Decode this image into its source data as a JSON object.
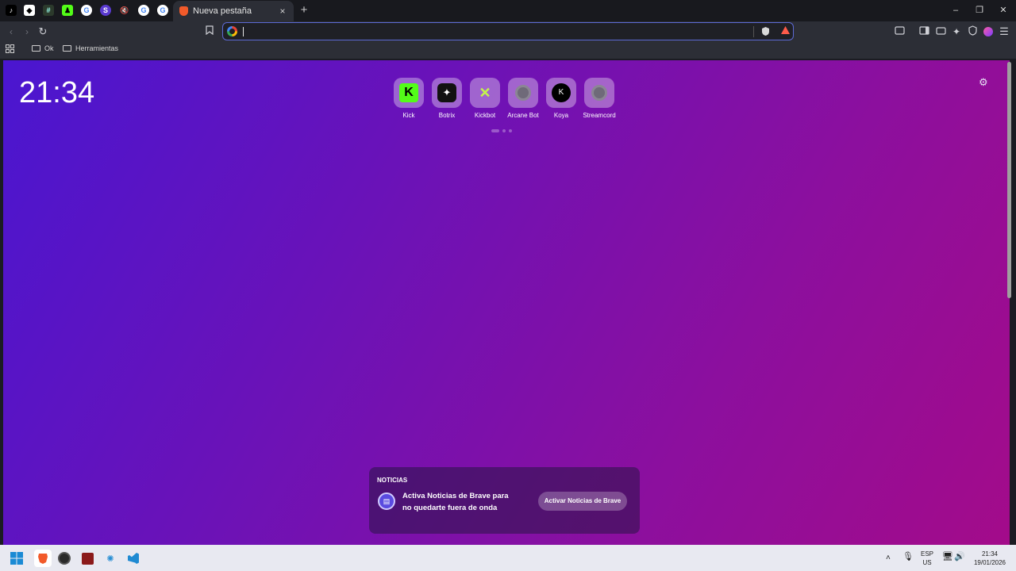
{
  "browser": {
    "active_tab_title": "Nueva pestaña",
    "close_tab": "×",
    "new_tab": "+",
    "window_controls": {
      "minimize": "–",
      "restore": "❐",
      "close": "✕"
    }
  },
  "bookmarks": [
    {
      "label": "Ok"
    },
    {
      "label": "Herramientas"
    }
  ],
  "newtab": {
    "clock": "21:34",
    "top_sites": [
      {
        "label": "Kick",
        "icon": "kick-icon",
        "letter": "K",
        "bg": "#53fc18",
        "fg": "#000000"
      },
      {
        "label": "Botrix",
        "icon": "botrix-icon",
        "letter": "✦",
        "bg": "#111111",
        "fg": "#ffffff"
      },
      {
        "label": "Kickbot",
        "icon": "kickbot-icon",
        "letter": "✕",
        "bg": "#c4f54a",
        "fg": "#5a2fd0"
      },
      {
        "label": "Arcane Bot",
        "icon": "globe-icon",
        "letter": "",
        "bg": "",
        "fg": ""
      },
      {
        "label": "Koya",
        "icon": "koya-icon",
        "letter": "K",
        "bg": "#000000",
        "fg": "#ffffff"
      },
      {
        "label": "Streamcord",
        "icon": "globe-icon",
        "letter": "",
        "bg": "",
        "fg": ""
      }
    ],
    "news": {
      "heading": "NOTICIAS",
      "message": "Activa Noticias de Brave para no quedarte fuera de onda",
      "button": "Activar Noticias de Brave"
    }
  },
  "taskbar": {
    "language": "ESP",
    "layout": "US",
    "time": "21:34",
    "date": "19/01/2026"
  },
  "colors": {
    "accent": "#5d6ad4",
    "gradient_start": "#4a16d0",
    "gradient_end": "#a30b8a"
  }
}
